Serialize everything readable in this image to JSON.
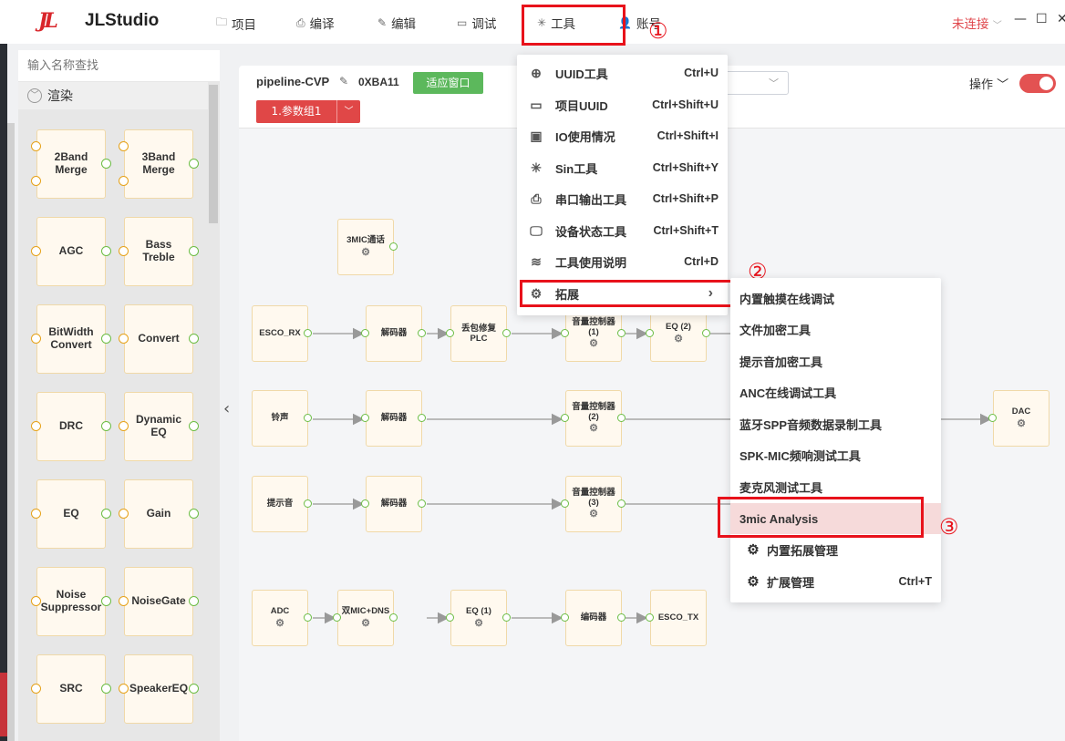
{
  "app": {
    "title": "JLStudio",
    "logo_text": "JL"
  },
  "menubar": [
    {
      "label": "项目",
      "icon": "folder-icon",
      "glyph": "🗀"
    },
    {
      "label": "编译",
      "icon": "print-icon",
      "glyph": "⎙"
    },
    {
      "label": "编辑",
      "icon": "pencil-icon",
      "glyph": "✎"
    },
    {
      "label": "调试",
      "icon": "monitor-icon",
      "glyph": "▭"
    },
    {
      "label": "工具",
      "icon": "loader-icon",
      "glyph": "✳"
    },
    {
      "label": "账号",
      "icon": "user-icon",
      "glyph": "👤"
    }
  ],
  "status": {
    "connection": "未连接"
  },
  "window": {
    "minimize": "—",
    "maximize": "☐",
    "close": "✕"
  },
  "annotations": {
    "n1": "①",
    "n2": "②",
    "n3": "③"
  },
  "sidebar": {
    "search_placeholder": "输入名称查找",
    "category": "渲染",
    "blocks": [
      "2Band Merge",
      "3Band Merge",
      "AGC",
      "Bass Treble",
      "BitWidth Convert",
      "Convert",
      "DRC",
      "Dynamic EQ",
      "EQ",
      "Gain",
      "Noise Suppressor",
      "NoiseGate",
      "SRC",
      "SpeakerEQ"
    ]
  },
  "toolbar": {
    "pipeline_name": "pipeline-CVP",
    "address": "0XBA11",
    "fit_label": "适应窗口",
    "param_group": "1.参数组1",
    "operation_label": "操作 ﹀"
  },
  "canvas": {
    "nodes": {
      "mic3": "3MIC通话",
      "esco_rx": "ESCO_RX",
      "dec1": "解码器",
      "plc": "丢包修复 PLC",
      "vol1": "音量控制器 (1)",
      "eq2": "EQ (2)",
      "ring": "铃声",
      "dec2": "解码器",
      "vol2": "音量控制器 (2)",
      "dac": "DAC",
      "prompt": "提示音",
      "dec3": "解码器",
      "vol3": "音量控制器 (3)",
      "adc": "ADC",
      "dns": "双MIC+DNS",
      "eq1": "EQ (1)",
      "enc": "编码器",
      "esco_tx": "ESCO_TX"
    }
  },
  "tools_menu": [
    {
      "label": "UUID工具",
      "shortcut": "Ctrl+U",
      "icon": "crosshair-icon",
      "glyph": "⊕"
    },
    {
      "label": "项目UUID",
      "shortcut": "Ctrl+Shift+U",
      "icon": "tray-icon",
      "glyph": "▭"
    },
    {
      "label": "IO使用情况",
      "shortcut": "Ctrl+Shift+I",
      "icon": "chip-icon",
      "glyph": "▣"
    },
    {
      "label": "Sin工具",
      "shortcut": "Ctrl+Shift+Y",
      "icon": "loader-icon",
      "glyph": "✳"
    },
    {
      "label": "串口输出工具",
      "shortcut": "Ctrl+Shift+P",
      "icon": "printer-icon",
      "glyph": "⎙"
    },
    {
      "label": "设备状态工具",
      "shortcut": "Ctrl+Shift+T",
      "icon": "monitor-icon",
      "glyph": "🖵"
    },
    {
      "label": "工具使用说明",
      "shortcut": "Ctrl+D",
      "icon": "database-icon",
      "glyph": "≋"
    },
    {
      "label": "拓展",
      "shortcut": "",
      "icon": "gear-icon",
      "glyph": "⚙"
    }
  ],
  "extend_menu": [
    {
      "label": "内置触摸在线调试",
      "shortcut": ""
    },
    {
      "label": "文件加密工具",
      "shortcut": ""
    },
    {
      "label": "提示音加密工具",
      "shortcut": ""
    },
    {
      "label": "ANC在线调试工具",
      "shortcut": ""
    },
    {
      "label": "蓝牙SPP音频数据录制工具",
      "shortcut": ""
    },
    {
      "label": "SPK-MIC频响测试工具",
      "shortcut": ""
    },
    {
      "label": "麦克风测试工具",
      "shortcut": ""
    },
    {
      "label": "3mic Analysis",
      "shortcut": ""
    },
    {
      "label": "内置拓展管理",
      "shortcut": ""
    },
    {
      "label": "扩展管理",
      "shortcut": "Ctrl+T"
    }
  ]
}
